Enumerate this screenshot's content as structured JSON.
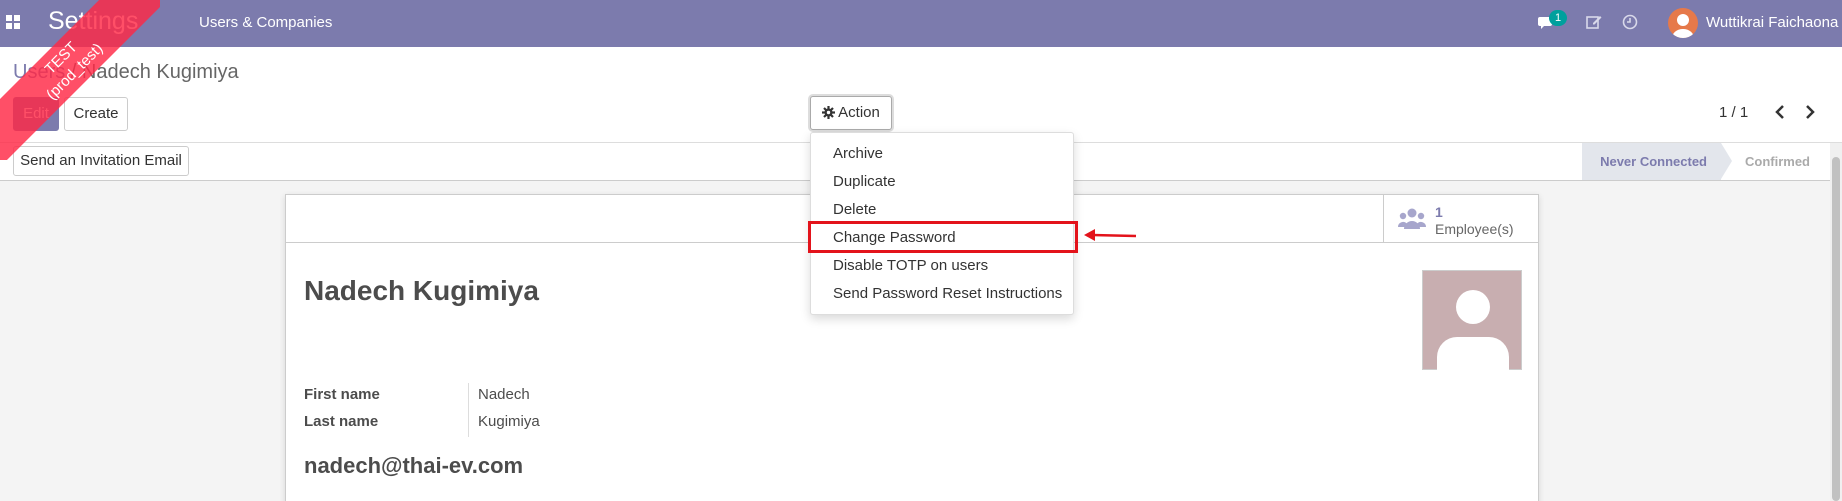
{
  "navbar": {
    "brand": "Settings",
    "menu_item": "Users & Companies",
    "chat_badge": "1",
    "user_name": "Wuttikrai Faichaona"
  },
  "ribbon": {
    "line1": "TEST",
    "line2": "(prod_test)"
  },
  "breadcrumb": {
    "parent": "Users",
    "separator": " / ",
    "current": "Nadech Kugimiya"
  },
  "toolbar": {
    "edit_label": "Edit",
    "create_label": "Create",
    "action_label": "Action"
  },
  "pager": {
    "value": "1 / 1"
  },
  "statusbar": {
    "invite_label": "Send an Invitation Email",
    "steps": [
      "Never Connected",
      "Confirmed"
    ],
    "active_step": "Never Connected"
  },
  "action_menu": {
    "items": [
      "Archive",
      "Duplicate",
      "Delete",
      "Change Password",
      "Disable TOTP on users",
      "Send Password Reset Instructions"
    ],
    "highlighted": "Change Password"
  },
  "stat_button": {
    "count": "1",
    "label": "Employee(s)"
  },
  "form": {
    "name": "Nadech Kugimiya",
    "first_name_label": "First name",
    "first_name_value": "Nadech",
    "last_name_label": "Last name",
    "last_name_value": "Kugimiya",
    "email": "nadech@thai-ev.com"
  },
  "colors": {
    "navbar": "#7c7bad",
    "accent": "#7c7bad",
    "badge": "#00a09d",
    "highlight_box": "#e3131b",
    "ribbon": "#ff2846"
  }
}
